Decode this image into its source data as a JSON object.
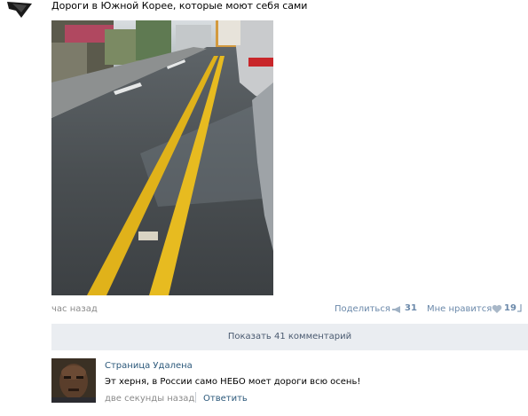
{
  "post": {
    "text": "Дороги в Южной Корее, которые моют себя сами",
    "time": "час назад",
    "share_label": "Поделиться",
    "share_count": "31",
    "like_label": "Мне нравится",
    "like_count": "19"
  },
  "comments": {
    "show_label": "Показать 41 комментарий",
    "items": [
      {
        "author": "Страница Удалена",
        "text": "Эт херня, в России само НЕБО моет дороги всю осень!",
        "time": "две секунды назад",
        "reply_label": "Ответить"
      }
    ]
  },
  "icons": {
    "share": "megaphone-icon",
    "like": "heart-icon"
  },
  "colors": {
    "link": "#2b587a",
    "muted_link": "#6b89aa",
    "meta": "#8a8a8a",
    "bar_bg": "#eaedf1"
  }
}
